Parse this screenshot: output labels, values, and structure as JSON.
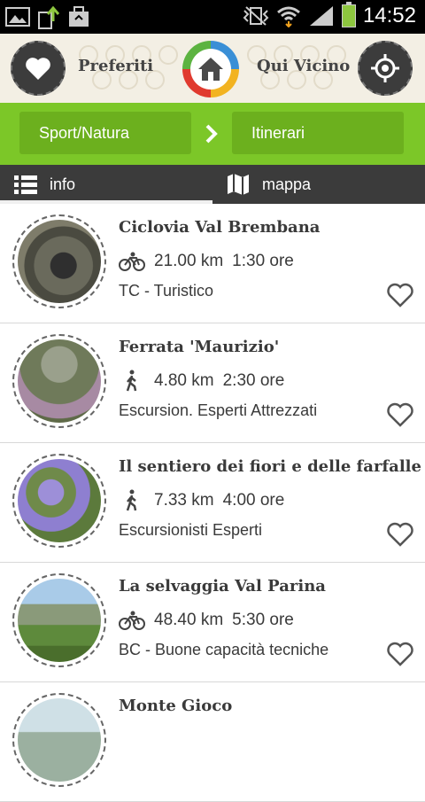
{
  "status_bar": {
    "time": "14:52"
  },
  "header": {
    "favorites_label": "Preferiti",
    "nearby_label": "Qui Vicino"
  },
  "breadcrumb": {
    "first": "Sport/Natura",
    "second": "Itinerari"
  },
  "tabs": [
    {
      "label": "info"
    },
    {
      "label": "mappa"
    }
  ],
  "colors": {
    "accent_green": "#7cc728",
    "dark": "#3b3b3b"
  },
  "items": [
    {
      "title": "Ciclovia Val Brembana",
      "activity_icon": "bike-icon",
      "distance": "21.00 km",
      "duration": "1:30 ore",
      "difficulty": "TC - Turistico"
    },
    {
      "title": "Ferrata 'Maurizio'",
      "activity_icon": "hiker-icon",
      "distance": "4.80 km",
      "duration": "2:30 ore",
      "difficulty": "Escursion. Esperti Attrezzati"
    },
    {
      "title": "Il sentiero dei fiori e delle farfalle",
      "activity_icon": "hiker-icon",
      "distance": "7.33 km",
      "duration": "4:00 ore",
      "difficulty": "Escursionisti Esperti"
    },
    {
      "title": "La selvaggia Val Parina",
      "activity_icon": "bike-icon",
      "distance": "48.40 km",
      "duration": "5:30 ore",
      "difficulty": "BC - Buone capacità tecniche"
    },
    {
      "title": "Monte Gioco",
      "activity_icon": "",
      "distance": "",
      "duration": "",
      "difficulty": ""
    }
  ]
}
